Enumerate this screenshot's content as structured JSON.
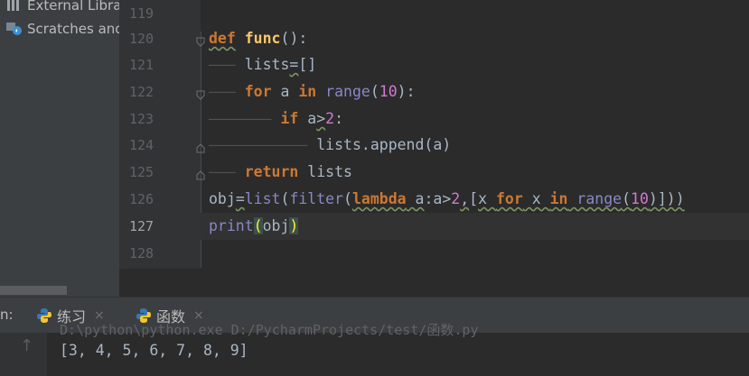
{
  "project": {
    "items": [
      {
        "label": "External Libraries",
        "icon": "library-icon"
      },
      {
        "label": "Scratches and Consoles",
        "icon": "scratches-icon"
      }
    ]
  },
  "editor": {
    "lines": [
      {
        "num": "119"
      },
      {
        "num": "120"
      },
      {
        "num": "121"
      },
      {
        "num": "122"
      },
      {
        "num": "123"
      },
      {
        "num": "124"
      },
      {
        "num": "125"
      },
      {
        "num": "126"
      },
      {
        "num": "127"
      },
      {
        "num": "128"
      }
    ],
    "current_line": "127",
    "tokens": {
      "l120_def": "def",
      "l120_name": "func",
      "l120_open": "(",
      "l120_close": ")",
      "l120_colon": ":",
      "l121_indent": "——— ",
      "l121_var": "lists",
      "l121_eq": "=",
      "l121_val": "[]",
      "l122_indent": "——— ",
      "l122_for": "for",
      "l122_var": " a ",
      "l122_in": "in",
      "l122_range": " range",
      "l122_open": "(",
      "l122_num": "10",
      "l122_close": "):",
      "l123_indent": "——————— ",
      "l123_if": "if",
      "l123_a": " a",
      "l123_gt": ">",
      "l123_num": "2",
      "l123_colon": ":",
      "l124_indent": "——————————— ",
      "l124_code": "lists.append(a)",
      "l125_indent": "——— ",
      "l125_return": "return",
      "l125_var": " lists",
      "l126_obj": "obj",
      "l126_eq": "=",
      "l126_list": "list",
      "l126_p1": "(",
      "l126_filter": "filter",
      "l126_p2": "(",
      "l126_lambda": "lambda",
      "l126_a": " a",
      "l126_colon": ":",
      "l126_agt": "a>",
      "l126_two": "2",
      "l126_comma": ",",
      "l126_lb": "[",
      "l126_x": "x ",
      "l126_for": "for",
      "l126_x2": " x ",
      "l126_in": "in",
      "l126_range": " range",
      "l126_p3": "(",
      "l126_ten": "10",
      "l126_close": ")]))",
      "l127_print": "print",
      "l127_open": "(",
      "l127_obj": "obj",
      "l127_close": ")"
    }
  },
  "run": {
    "label": "n:",
    "tabs": [
      {
        "label": "练习",
        "close": "×"
      },
      {
        "label": "函数",
        "close": "×"
      }
    ],
    "console_path": "D:\\python\\python.exe D:/PycharmProjects/test/函数.py",
    "output": "[3, 4, 5, 6, 7, 8, 9]"
  },
  "colors": {
    "keyword": "#cc7832",
    "function_name": "#ffc66d",
    "builtin": "#8888c6",
    "number": "#6897bb",
    "current_line": "#323232"
  }
}
